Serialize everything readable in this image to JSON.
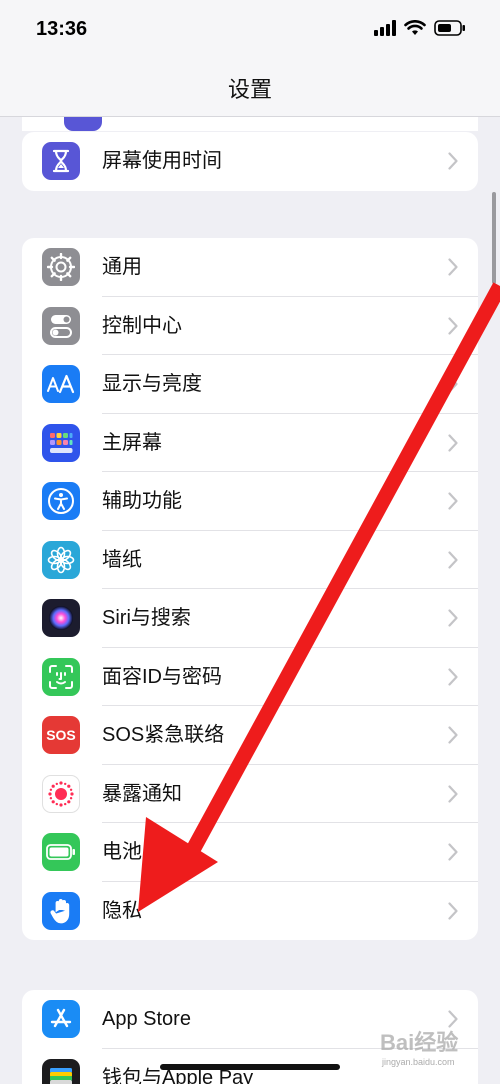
{
  "status_bar": {
    "time": "13:36"
  },
  "nav": {
    "title": "设置"
  },
  "group1": [
    {
      "label": "屏幕使用时间",
      "icon": "hourglass-icon",
      "color": "#5856d6"
    }
  ],
  "group2": [
    {
      "label": "通用",
      "icon": "gear-icon",
      "color": "#8e8e93"
    },
    {
      "label": "控制中心",
      "icon": "toggles-icon",
      "color": "#8e8e93"
    },
    {
      "label": "显示与亮度",
      "icon": "text-size-icon",
      "color": "#1a7cf5"
    },
    {
      "label": "主屏幕",
      "icon": "app-grid-icon",
      "color": "#2f54eb"
    },
    {
      "label": "辅助功能",
      "icon": "accessibility-icon",
      "color": "#1a7cf5"
    },
    {
      "label": "墙纸",
      "icon": "flower-icon",
      "color": "#2aa7d8"
    },
    {
      "label": "Siri与搜索",
      "icon": "siri-icon",
      "color": "#1c1c2e"
    },
    {
      "label": "面容ID与密码",
      "icon": "face-id-icon",
      "color": "#34c759"
    },
    {
      "label": "SOS紧急联络",
      "icon": "sos-icon",
      "color": "#e53935"
    },
    {
      "label": "暴露通知",
      "icon": "exposure-icon",
      "color": "#ffffff"
    },
    {
      "label": "电池",
      "icon": "battery-icon",
      "color": "#34c759"
    },
    {
      "label": "隐私",
      "icon": "hand-icon",
      "color": "#1a7cf5"
    }
  ],
  "group3": [
    {
      "label": "App Store",
      "icon": "app-store-icon",
      "color": "#1a8cf5"
    },
    {
      "label": "钱包与Apple Pay",
      "icon": "wallet-icon",
      "color": "#1c1c1e"
    }
  ],
  "watermark": {
    "text": "Bai经验",
    "sub": "jingyan.baidu.com"
  },
  "annotation_color": "#ee1c1c"
}
